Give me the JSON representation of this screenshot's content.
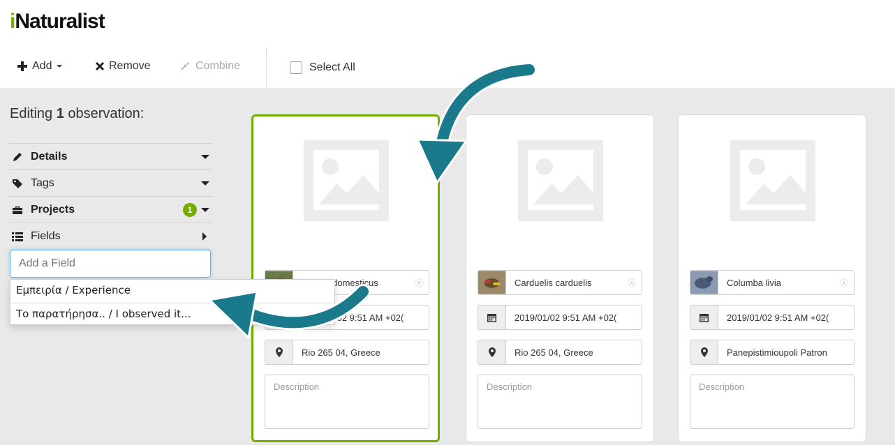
{
  "app": {
    "logo_i": "i",
    "logo_rest": "Naturalist"
  },
  "toolbar": {
    "add_label": "Add",
    "remove_label": "Remove",
    "combine_label": "Combine",
    "select_all_label": "Select All"
  },
  "sidebar": {
    "title_prefix": "Editing ",
    "count": "1",
    "title_suffix": " observation:",
    "sections": [
      {
        "label": "Details",
        "icon": "pencil-icon"
      },
      {
        "label": "Tags",
        "icon": "tag-icon"
      },
      {
        "label": "Projects",
        "icon": "briefcase-icon",
        "badge": "1"
      },
      {
        "label": "Fields",
        "icon": "list-icon"
      }
    ],
    "add_field_placeholder": "Add a Field",
    "field_options": [
      "Εμπειρία / Experience",
      "Το παρατήρησα.. / I observed it..."
    ]
  },
  "cards": [
    {
      "species": "Passer domesticus",
      "date": "2019/01/02 9:51 AM +02(",
      "place": "Rio 265 04, Greece",
      "description_placeholder": "Description",
      "selected": true
    },
    {
      "species": "Carduelis carduelis",
      "date": "2019/01/02 9:51 AM +02(",
      "place": "Rio 265 04, Greece",
      "description_placeholder": "Description",
      "selected": false
    },
    {
      "species": "Columba livia",
      "date": "2019/01/02 9:51 AM +02(",
      "place": "Panepistimioupoli Patron",
      "description_placeholder": "Description",
      "selected": false
    }
  ],
  "colors": {
    "brand_green": "#74ac00",
    "arrow_teal": "#1a7a8c",
    "panel_grey": "#e9e9e9"
  }
}
